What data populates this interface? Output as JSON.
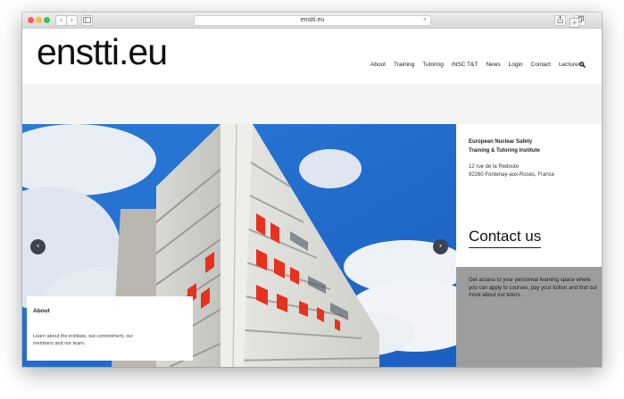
{
  "browser": {
    "url": "enstti.eu",
    "back_glyph": "‹",
    "forward_glyph": "›",
    "close_glyph": "×",
    "new_tab_glyph": "+"
  },
  "header": {
    "logo": "enstti.eu",
    "menu": [
      "About",
      "Training",
      "Tutoring",
      "INSC T&T",
      "News",
      "Login",
      "Contact",
      "Lecturers"
    ]
  },
  "hero": {
    "prev_glyph": "‹",
    "next_glyph": "›",
    "about_title": "About",
    "about_text": "Learn about the institute, out commitment, our members and our team."
  },
  "info": {
    "institute_line1": "European Nuclear Safety",
    "institute_line2": "Training & Tutoring Institute",
    "address_line1": "12 rue de la Redoute",
    "address_line2": "92260 Fontenay-aux-Roses, France",
    "contact_label": "Contact us",
    "promo_text": "Get access to your personnal learning space where you can apply to courses, pay your tuition and find out more about our tutors."
  },
  "colors": {
    "accent_dark": "#3b4350",
    "panel_gray": "#9d9d9d",
    "sky_blue": "#1f63c4",
    "facade_red": "#e8321f"
  }
}
